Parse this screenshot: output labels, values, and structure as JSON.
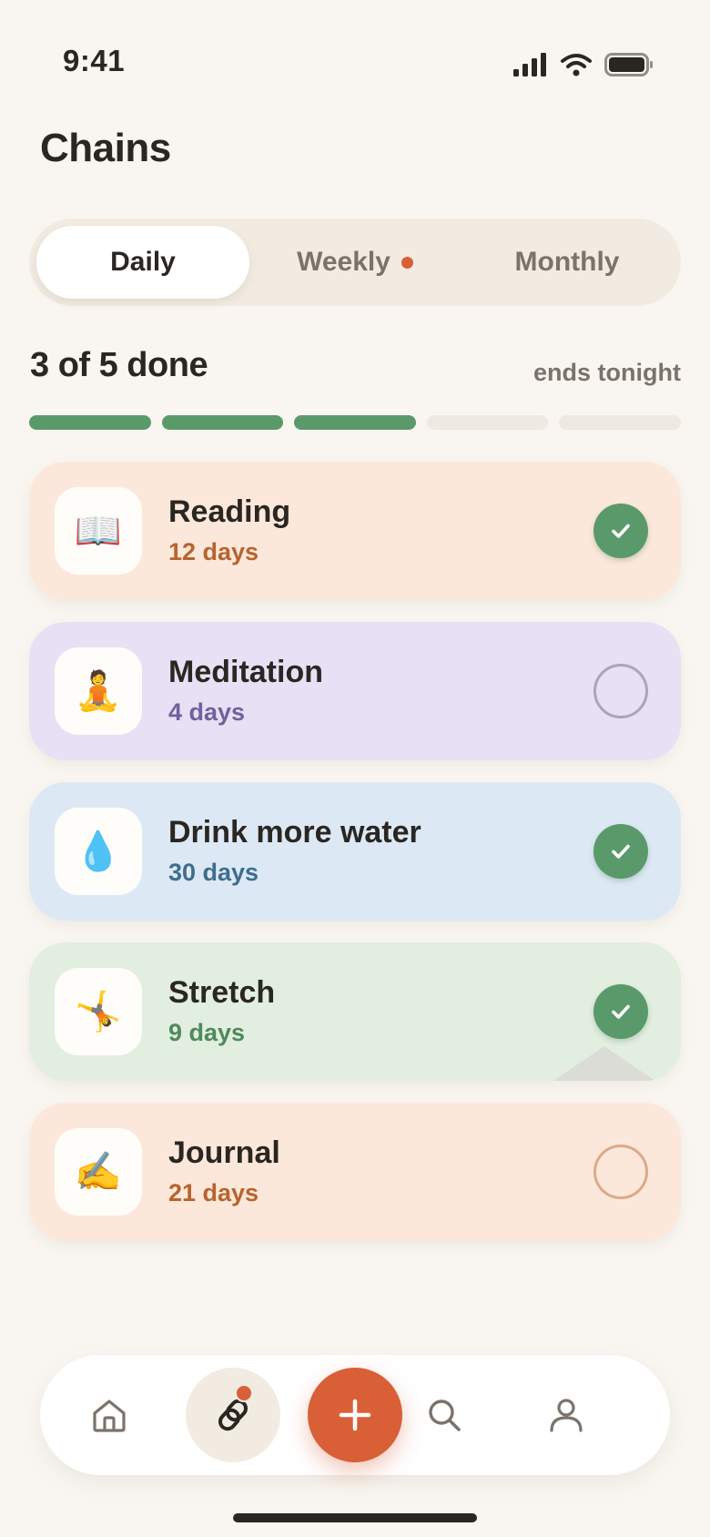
{
  "status_bar": {
    "time": "9:41",
    "signal_icon": "cellular-signal-icon",
    "wifi_icon": "wifi-icon",
    "battery_icon": "battery-icon"
  },
  "header": {
    "title": "Chains"
  },
  "tabs": [
    {
      "label": "Daily",
      "active": true,
      "has_dot": false
    },
    {
      "label": "Weekly",
      "active": false,
      "has_dot": true
    },
    {
      "label": "Monthly",
      "active": false,
      "has_dot": false
    }
  ],
  "progress": {
    "label": "3 of 5 done",
    "meta": "ends tonight",
    "completed": 3,
    "total": 5
  },
  "habits": [
    {
      "name": "Reading",
      "streak": "12 days",
      "icon": "📖",
      "icon_name": "book-icon",
      "done": true,
      "bg": "#fce8da",
      "accent": "#b8632e"
    },
    {
      "name": "Meditation",
      "streak": "4 days",
      "icon": "🧘",
      "icon_name": "meditation-icon",
      "done": false,
      "bg": "#e8e0f4",
      "accent": "#72609e"
    },
    {
      "name": "Drink more water",
      "streak": "30 days",
      "icon": "💧",
      "icon_name": "droplet-icon",
      "done": true,
      "bg": "#dce9f4",
      "accent": "#3f6d8e"
    },
    {
      "name": "Stretch",
      "streak": "9 days",
      "icon": "🤸",
      "icon_name": "stretch-icon",
      "done": true,
      "bg": "#e2eee0",
      "accent": "#4f8a5a"
    },
    {
      "name": "Journal",
      "streak": "21 days",
      "icon": "✍️",
      "icon_name": "writing-hand-icon",
      "done": false,
      "bg": "#fce8da",
      "accent": "#b8632e"
    }
  ],
  "colors": {
    "accent": "#d95f36",
    "success": "#5a9a6a",
    "background": "#f9f6f1",
    "text": "#2a2622",
    "muted": "#7b736b"
  },
  "bottom_nav": [
    {
      "icon": "home-icon",
      "active": false
    },
    {
      "icon": "chains-icon",
      "active": true,
      "badge": true
    },
    {
      "icon": "plus-icon",
      "primary": true
    },
    {
      "icon": "search-icon",
      "active": false
    },
    {
      "icon": "profile-icon",
      "active": false
    }
  ]
}
